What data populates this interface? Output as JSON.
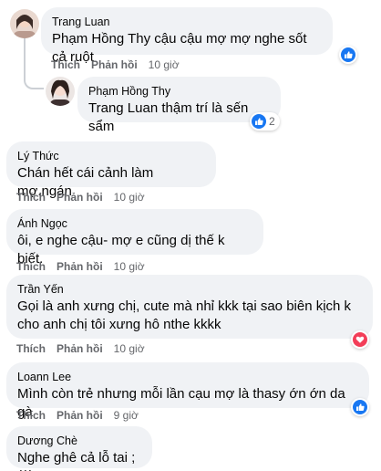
{
  "labels": {
    "like": "Thích",
    "reply": "Phản hồi"
  },
  "colors": {
    "like_blue": "#1877f2",
    "love_red": "#f33e58"
  },
  "comments": [
    {
      "author": "Trang Luan",
      "tag": "Phạm Hồng Thy",
      "text": " cậu cậu mợ mợ nghe sốt cả ruột",
      "time": "10 giờ",
      "reaction": "like-icon"
    },
    {
      "author": "Phạm Hồng Thy",
      "tag": "Trang Luan",
      "text": " thậm trí là sến sẩm",
      "time": "",
      "reaction": "like-icon",
      "reaction_count": "2"
    },
    {
      "author": "Lý Thức",
      "text": "Chán hết cái cảnh làm mợ.ngán",
      "time": "10 giờ"
    },
    {
      "author": "Ánh Ngọc",
      "text": "ôi, e nghe cậu- mợ e cũng dị thế k biết.",
      "time": "10 giờ"
    },
    {
      "author": "Trần Yến",
      "text": "Gọi là anh xưng chị, cute mà nhỉ kkk tại sao biên kịch k cho anh chị tôi xưng hô nthe kkkk",
      "time": "10 giờ",
      "reaction": "love-icon"
    },
    {
      "author": "Loann Lee",
      "text": "Mình còn trẻ nhưng mỗi lần cạu mợ là thasy ớn ớn da gà",
      "time": "9 giờ",
      "reaction": "like-icon"
    },
    {
      "author": "Dương Chè",
      "text": "Nghe ghê cả lỗ tai ;(((",
      "time": ""
    }
  ]
}
